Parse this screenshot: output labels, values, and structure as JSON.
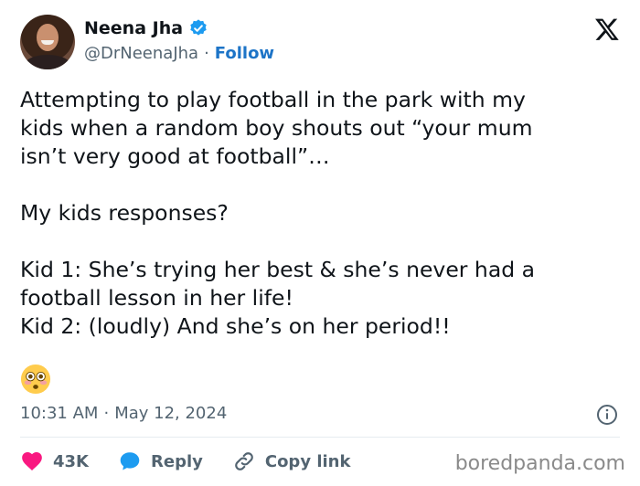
{
  "author": {
    "name": "Neena Jha",
    "handle": "@DrNeenaJha",
    "separator": "·",
    "follow_label": "Follow"
  },
  "tweet": {
    "text": "Attempting to play football in the park with my\nkids when a random boy shouts out “your mum\nisn’t very good at football”…\n\nMy kids responses?\n\nKid 1: She’s trying her best & she’s never had a\nfootball lesson in her life!\nKid 2: (loudly) And she’s on her period!!",
    "time": "10:31 AM",
    "separator": "·",
    "date": "May 12, 2024"
  },
  "actions": {
    "likes": "43K",
    "reply_label": "Reply",
    "copy_label": "Copy link"
  },
  "watermark": "boredpanda.com",
  "icons": {
    "verified": "verified-badge-icon",
    "x_logo": "x-logo-icon",
    "emoji": "flushed-face-emoji",
    "info": "info-icon",
    "like": "heart-icon",
    "reply": "speech-bubble-icon",
    "copy": "link-icon"
  },
  "colors": {
    "verified": "#1d9bf0",
    "follow": "#1d74c7",
    "heart": "#f91880",
    "reply_bubble": "#1d9bf0",
    "muted": "#536471"
  }
}
